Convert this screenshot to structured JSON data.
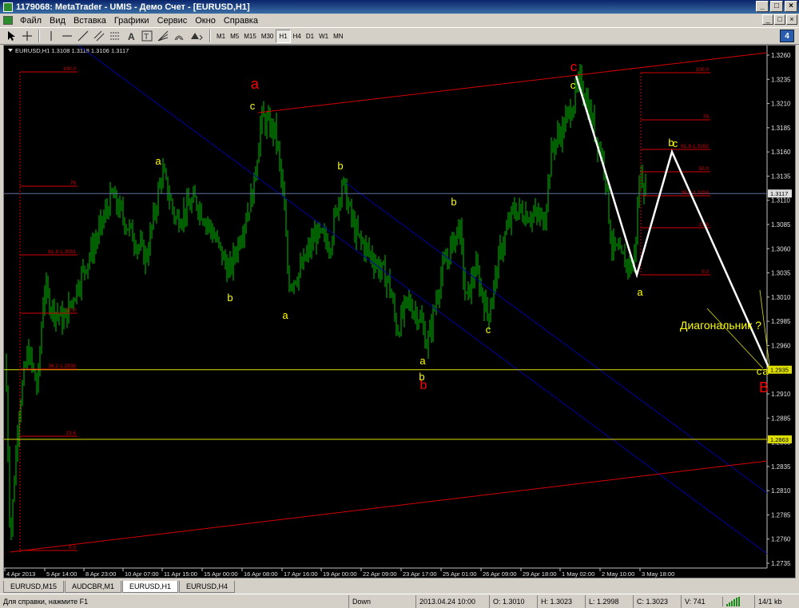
{
  "window": {
    "title": "1179068: MetaTrader - UMIS - Демо Счет - [EURUSD,H1]",
    "controls": [
      "_",
      "□",
      "×"
    ]
  },
  "menu": {
    "items": [
      "Файл",
      "Вид",
      "Вставка",
      "Графики",
      "Сервис",
      "Окно",
      "Справка"
    ],
    "mdi_controls": [
      "_",
      "□",
      "×"
    ]
  },
  "toolbar": {
    "tools": [
      "cursor-icon",
      "crosshair-icon",
      "vertical-line-icon",
      "horizontal-line-icon",
      "trendline-icon",
      "equidistant-channel-icon",
      "fibonacci-icon",
      "text-icon",
      "text-label-icon",
      "fibo-fan-icon",
      "fibo-arcs-icon",
      "arrows-icon"
    ],
    "timeframes": [
      "M1",
      "M5",
      "M15",
      "M30",
      "H1",
      "H4",
      "D1",
      "W1",
      "MN"
    ],
    "active_timeframe": "H1",
    "right_badge": "4"
  },
  "chart": {
    "header": "EURUSD,H1  1.3108 1.3118 1.3106 1.3117",
    "background": "#000000",
    "candle_color": "#00c000",
    "price_scale": [
      "1.3260",
      "1.3235",
      "1.3210",
      "1.3185",
      "1.3160",
      "1.3135",
      "1.3110",
      "1.3085",
      "1.3060",
      "1.3035",
      "1.3010",
      "1.2985",
      "1.2960",
      "1.2935",
      "1.2910",
      "1.2885",
      "1.2860",
      "1.2835",
      "1.2810",
      "1.2785",
      "1.2760",
      "1.2735"
    ],
    "price_tags": [
      {
        "label": "1.3117",
        "style": "current"
      },
      {
        "label": "1.2935",
        "style": "level"
      },
      {
        "label": "1.2863",
        "style": "level"
      }
    ],
    "time_scale": [
      "4 Apr 2013",
      "5 Apr 14:00",
      "8 Apr 23:00",
      "10 Apr 07:00",
      "11 Apr 15:00",
      "15 Apr 00:00",
      "16 Apr 08:00",
      "17 Apr 16:00",
      "19 Apr 00:00",
      "22 Apr 09:00",
      "23 Apr 17:00",
      "25 Apr 01:00",
      "26 Apr 09:00",
      "29 Apr 18:00",
      "1 May 02:00",
      "2 May 10:00",
      "3 May 18:00"
    ],
    "fib_left": [
      "100.0",
      "76",
      "61.8-1.3051",
      "50.0",
      "38.2-1.2935",
      "23.6",
      "0.0"
    ],
    "fib_right": [
      "100.0",
      "76",
      "61.8-1.3162",
      "50.0",
      "38.2-1.3116",
      "23.6",
      "0.0"
    ],
    "wave_labels": {
      "red": [
        "a",
        "b",
        "c",
        "B"
      ],
      "yellow": [
        "a",
        "b",
        "c",
        "b",
        "a",
        "b",
        "a",
        "c",
        "b",
        "c",
        "a",
        "b",
        "a",
        "c",
        "c"
      ]
    },
    "annotation": "Диагональник ?",
    "colors": {
      "fib": "#d40000",
      "channel": "#0000a0",
      "resistance": "#d40000",
      "level": "#e0e000",
      "wave": "#ffffff",
      "label_yellow": "#ffff00",
      "label_red": "#ff0000"
    }
  },
  "tabs": [
    {
      "label": "EURUSD,M15",
      "active": false
    },
    {
      "label": "AUDCBR,M1",
      "active": false
    },
    {
      "label": "EURUSD,H1",
      "active": true
    },
    {
      "label": "EURUSD,H4",
      "active": false
    }
  ],
  "status": {
    "help": "Для справки, нажмите F1",
    "profile": "Down",
    "datetime": "2013.04.24 10:00",
    "open": "O: 1.3010",
    "high": "H: 1.3023",
    "low": "L: 1.2998",
    "close": "C: 1.3023",
    "volume": "V: 741",
    "traffic": "14/1 kb"
  }
}
